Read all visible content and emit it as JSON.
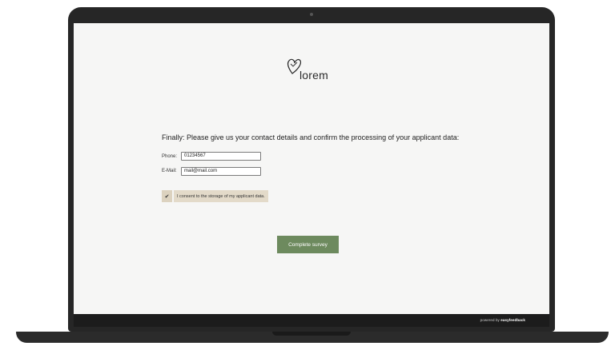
{
  "brand": {
    "logo_text": "lorem"
  },
  "survey": {
    "question": "Finally: Please give us your contact details and confirm the processing of your applicant data:",
    "phone": {
      "label": "Phone:",
      "value": "01234567"
    },
    "email": {
      "label": "E-Mail:",
      "value": "mail@mail.com"
    },
    "consent": {
      "checked": true,
      "check_glyph": "✔",
      "label": "I consent to the storage of my applicant data."
    },
    "submit_label": "Complete survey"
  },
  "footer": {
    "powered_prefix": "powered by",
    "powered_brand": "easyfeedback"
  },
  "colors": {
    "accent": "#6d8a5e",
    "consent_bg": "#e3dac9",
    "frame": "#262626"
  }
}
